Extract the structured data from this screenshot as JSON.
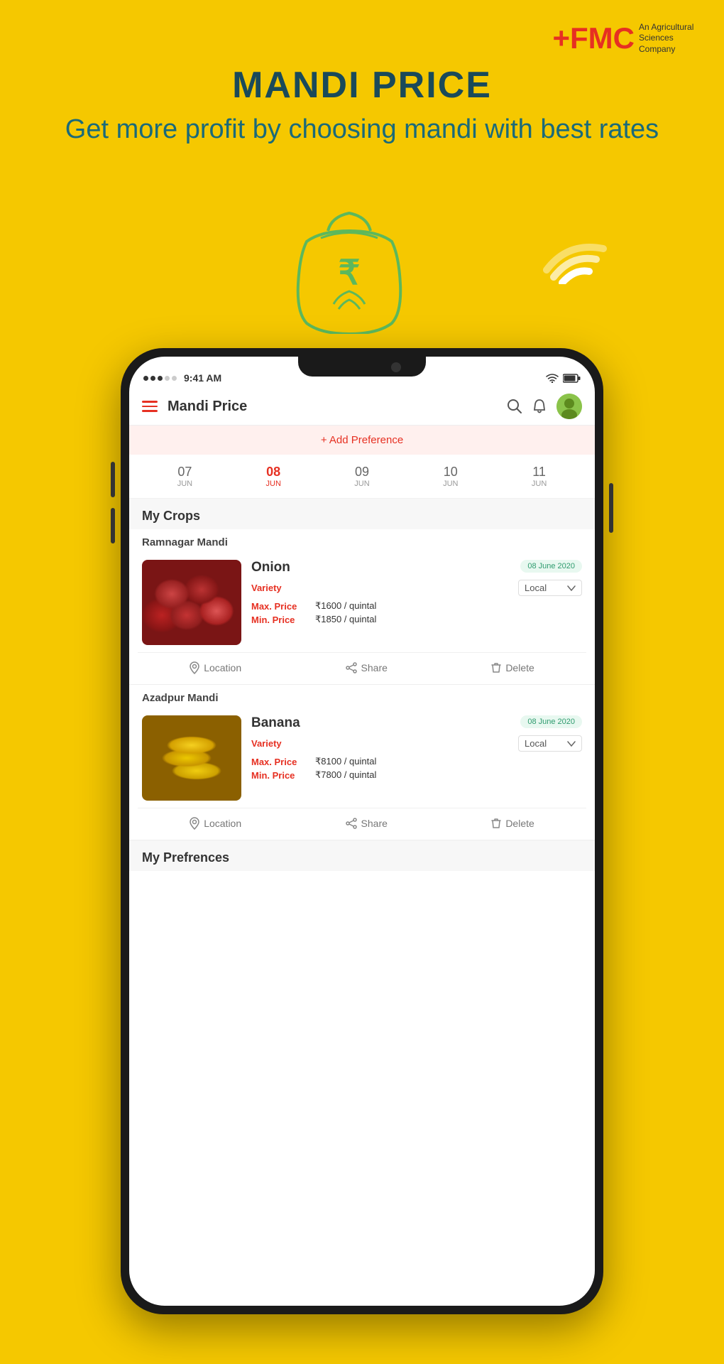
{
  "brand": {
    "fmc_plus": "+FMC",
    "tagline": "An Agricultural\nSciences Company",
    "color_primary": "#E63022"
  },
  "hero": {
    "title": "MANDI PRICE",
    "subtitle": "Get more profit by choosing mandi with best rates"
  },
  "app": {
    "title": "Mandi Price",
    "add_preference_label": "+ Add Preference",
    "status_time": "9:41 AM"
  },
  "dates": [
    {
      "num": "07",
      "month": "JUN",
      "active": false
    },
    {
      "num": "08",
      "month": "JUN",
      "active": true
    },
    {
      "num": "09",
      "month": "JUN",
      "active": false
    },
    {
      "num": "10",
      "month": "JUN",
      "active": false
    },
    {
      "num": "11",
      "month": "JUN",
      "active": false
    }
  ],
  "sections": {
    "my_crops": "My Crops",
    "my_preferences": "My Prefrences"
  },
  "mandis": [
    {
      "name": "Ramnagar Mandi",
      "crops": [
        {
          "name": "Onion",
          "date": "08 June 2020",
          "variety": "Local",
          "max_price": "₹1600 / quintal",
          "min_price": "₹1850 / quintal",
          "image_type": "onion"
        }
      ]
    },
    {
      "name": "Azadpur Mandi",
      "crops": [
        {
          "name": "Banana",
          "date": "08 June 2020",
          "variety": "Local",
          "max_price": "₹8100 / quintal",
          "min_price": "₹7800 / quintal",
          "image_type": "banana"
        }
      ]
    }
  ],
  "action_buttons": {
    "location": "Location",
    "share": "Share",
    "delete": "Delete"
  },
  "labels": {
    "variety": "Variety",
    "max_price": "Max. Price",
    "min_price": "Min. Price"
  }
}
